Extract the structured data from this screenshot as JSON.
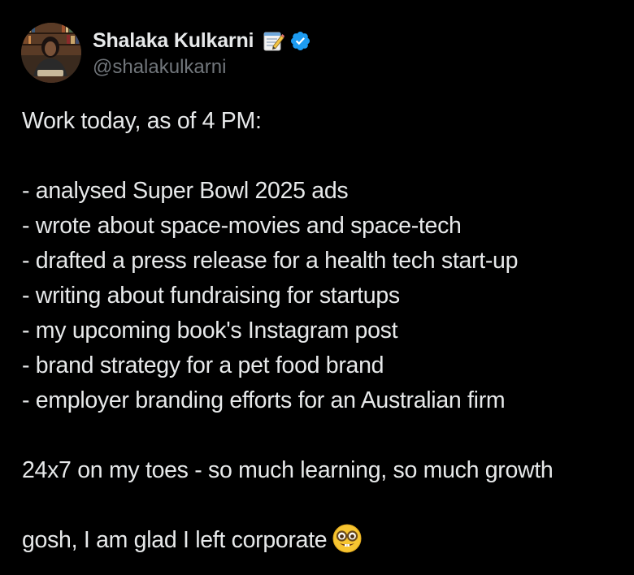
{
  "author": {
    "display_name": "Shalaka Kulkarni",
    "handle": "@shalakulkarni",
    "name_emoji": "memo-icon",
    "verified": true,
    "verified_color": "#1d9bf0"
  },
  "tweet": {
    "intro": "Work today, as of 4 PM:",
    "items": [
      "- analysed Super Bowl 2025 ads",
      "- wrote about space-movies and space-tech",
      "- drafted a press release for a health tech start-up",
      "- writing about fundraising for startups",
      "- my upcoming book's Instagram post",
      "- brand strategy for a pet food brand",
      "- employer branding efforts for an Australian firm"
    ],
    "line_2": "24x7 on my toes - so much learning, so much growth",
    "line_3": "gosh, I am glad I left corporate",
    "line_3_emoji": "nerd-face-icon"
  },
  "colors": {
    "background": "#000000",
    "text": "#e7e9ea",
    "secondary": "#71767b"
  }
}
